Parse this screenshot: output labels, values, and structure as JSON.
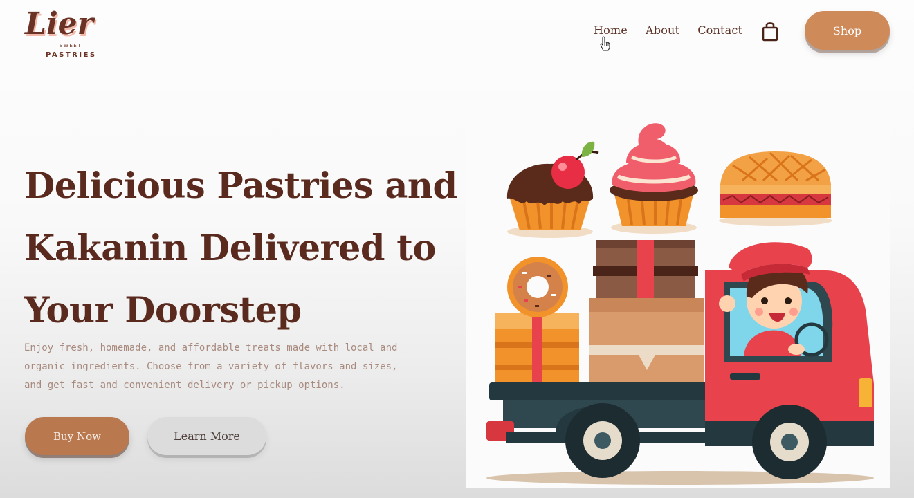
{
  "brand": {
    "logo_main": "Lier",
    "logo_sub_1": "SWEET",
    "logo_sub_2": "PASTRIES"
  },
  "nav": {
    "items": [
      {
        "label": "Home"
      },
      {
        "label": "About"
      },
      {
        "label": "Contact"
      }
    ],
    "shop_label": "Shop",
    "cart_icon": "shopping-bag-icon"
  },
  "hero": {
    "title_lines": [
      "Delicious Pastries and",
      "Kakanin Delivered to",
      "Your Doorstep"
    ],
    "description_lines": [
      "Enjoy fresh, homemade, and affordable treats made with local and",
      "organic ingredients. Choose from a variety of flavors and sizes,",
      "and get fast and convenient delivery or pickup options."
    ],
    "buy_label": "Buy Now",
    "learn_label": "Learn More"
  },
  "colors": {
    "brand_brown": "#5b2a1e",
    "accent_tan": "#cf8a5a",
    "button_brown": "#b9784d",
    "button_gray": "#dcdcdc",
    "truck_red": "#e8434d"
  }
}
